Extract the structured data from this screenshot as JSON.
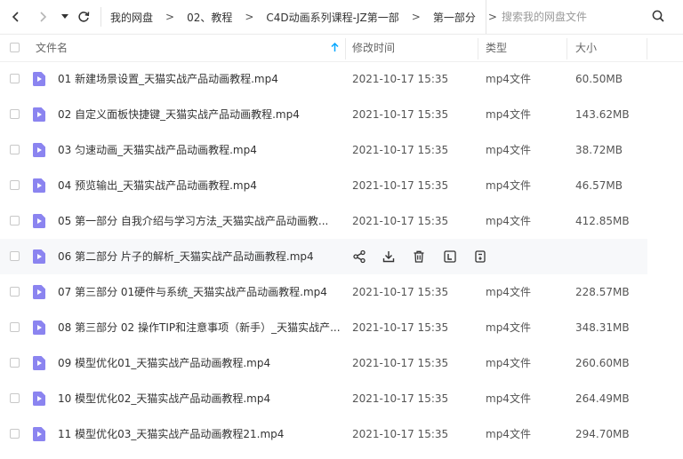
{
  "breadcrumb": [
    "我的网盘",
    "02、教程",
    "C4D动画系列课程-JZ第一部",
    "第一部分"
  ],
  "search": {
    "placeholder": "搜索我的网盘文件"
  },
  "columns": {
    "name": "文件名",
    "modified": "修改时间",
    "type": "类型",
    "size": "大小"
  },
  "colors": {
    "accent": "#06a7ff",
    "file_icon": "#8b84f0",
    "hover_row": "#f7f8fa"
  },
  "icons": {
    "nav": [
      "back-icon",
      "forward-icon",
      "dropdown-icon",
      "refresh-icon"
    ],
    "search": "search-icon",
    "row_actions": [
      "share-icon",
      "download-icon",
      "delete-icon",
      "rename-icon",
      "more-icon"
    ],
    "file": "video-file-icon",
    "sort": "sort-arrow-up-icon"
  },
  "files": [
    {
      "name": "01 新建场景设置_天猫实战产品动画教程.mp4",
      "date": "2021-10-17 15:35",
      "type": "mp4文件",
      "size": "60.50MB"
    },
    {
      "name": "02 自定义面板快捷键_天猫实战产品动画教程.mp4",
      "date": "2021-10-17 15:35",
      "type": "mp4文件",
      "size": "143.62MB"
    },
    {
      "name": "03 匀速动画_天猫实战产品动画教程.mp4",
      "date": "2021-10-17 15:35",
      "type": "mp4文件",
      "size": "38.72MB"
    },
    {
      "name": "04 预览输出_天猫实战产品动画教程.mp4",
      "date": "2021-10-17 15:35",
      "type": "mp4文件",
      "size": "46.57MB"
    },
    {
      "name": "05 第一部分  自我介绍与学习方法_天猫实战产品动画教...",
      "date": "2021-10-17 15:35",
      "type": "mp4文件",
      "size": "412.85MB"
    },
    {
      "name": "06 第二部分 片子的解析_天猫实战产品动画教程.mp4",
      "date": "",
      "type": "",
      "size": "",
      "hover": true
    },
    {
      "name": "07 第三部分 01硬件与系统_天猫实战产品动画教程.mp4",
      "date": "2021-10-17 15:35",
      "type": "mp4文件",
      "size": "228.57MB"
    },
    {
      "name": "08 第三部分 02 操作TIP和注意事项（新手）_天猫实战产...",
      "date": "2021-10-17 15:35",
      "type": "mp4文件",
      "size": "348.31MB"
    },
    {
      "name": "09 模型优化01_天猫实战产品动画教程.mp4",
      "date": "2021-10-17 15:35",
      "type": "mp4文件",
      "size": "260.60MB"
    },
    {
      "name": "10 模型优化02_天猫实战产品动画教程.mp4",
      "date": "2021-10-17 15:35",
      "type": "mp4文件",
      "size": "264.49MB"
    },
    {
      "name": "11 模型优化03_天猫实战产品动画教程21.mp4",
      "date": "2021-10-17 15:35",
      "type": "mp4文件",
      "size": "294.70MB"
    }
  ]
}
